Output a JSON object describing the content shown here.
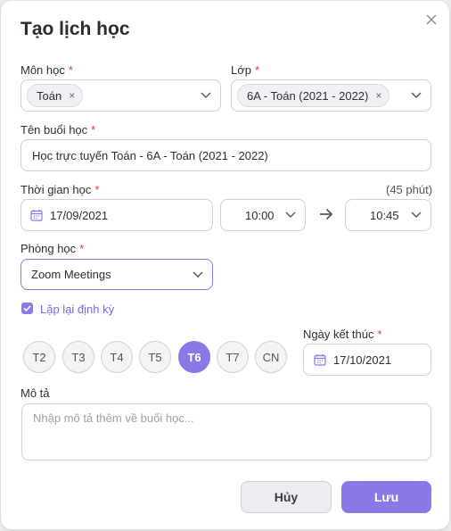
{
  "dialog": {
    "title": "Tạo lịch học"
  },
  "subject": {
    "label": "Môn học",
    "required": "*",
    "chip": "Toán",
    "chip_remove": "×"
  },
  "class": {
    "label": "Lớp",
    "required": "*",
    "chip": "6A - Toán (2021 - 2022)",
    "chip_remove": "×"
  },
  "session_name": {
    "label": "Tên buổi học",
    "required": "*",
    "value": "Học trực tuyến Toán - 6A - Toán (2021 - 2022)"
  },
  "time": {
    "label": "Thời gian học",
    "required": "*",
    "duration": "(45 phút)",
    "date": "17/09/2021",
    "start": "10:00",
    "end": "10:45"
  },
  "room": {
    "label": "Phòng học",
    "required": "*",
    "value": "Zoom Meetings"
  },
  "repeat": {
    "label": "Lặp lại định kỳ",
    "checked": true
  },
  "days": [
    {
      "label": "T2",
      "active": false
    },
    {
      "label": "T3",
      "active": false
    },
    {
      "label": "T4",
      "active": false
    },
    {
      "label": "T5",
      "active": false
    },
    {
      "label": "T6",
      "active": true
    },
    {
      "label": "T7",
      "active": false
    },
    {
      "label": "CN",
      "active": false
    }
  ],
  "end_date": {
    "label": "Ngày kết thúc",
    "required": "*",
    "value": "17/10/2021"
  },
  "description": {
    "label": "Mô tả",
    "placeholder": "Nhập mô tả thêm về buổi học..."
  },
  "buttons": {
    "cancel": "Hủy",
    "save": "Lưu"
  },
  "colors": {
    "accent": "#8b78e6",
    "required": "#e23b3b",
    "border": "#cfcfd8"
  }
}
